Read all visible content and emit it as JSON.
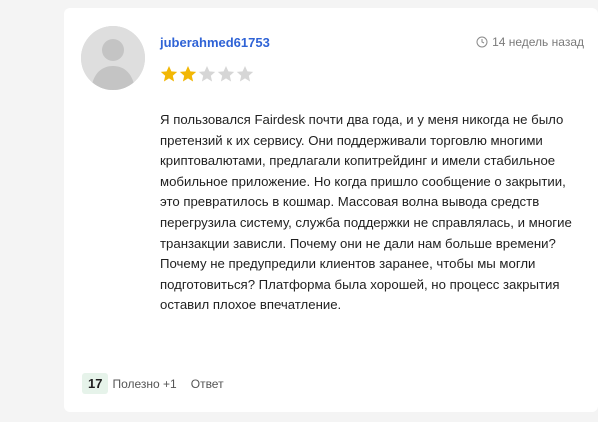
{
  "review": {
    "username": "juberahmed61753",
    "time_ago": "14 недель назад",
    "rating": 2,
    "max_rating": 5,
    "text": "Я пользовался Fairdesk почти два года, и у меня никогда не было претензий к их сервису. Они поддерживали торговлю многими криптовалютами, предлагали копитрейдинг и имели стабильное мобильное приложение. Но когда пришло сообщение о закрытии, это превратилось в кошмар. Массовая волна вывода средств перегрузила систему, служба поддержки не справлялась, и многие транзакции зависли. Почему они не дали нам больше времени? Почему не предупредили клиентов заранее, чтобы мы могли подготовиться? Платформа была хорошей, но процесс закрытия оставил плохое впечатление."
  },
  "footer": {
    "helpful_count": "17",
    "helpful_label": "Полезно +1",
    "reply_label": "Ответ"
  },
  "colors": {
    "star_filled": "#f2b705",
    "star_empty": "#d6d6d6",
    "username": "#2f63d6",
    "badge_bg": "#e6f3ea"
  }
}
